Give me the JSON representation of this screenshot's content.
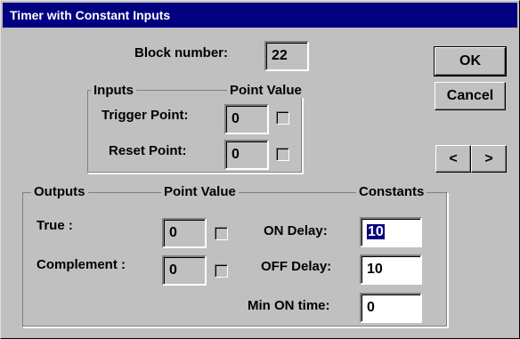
{
  "window": {
    "title": "Timer with Constant Inputs"
  },
  "block": {
    "label": "Block number:",
    "value": "22"
  },
  "inputs": {
    "group_label": "Inputs",
    "point_value_header": "Point Value",
    "trigger": {
      "label": "Trigger Point:",
      "value": "0",
      "checked": false
    },
    "reset": {
      "label": "Reset Point:",
      "value": "0",
      "checked": false
    }
  },
  "outputs": {
    "group_label": "Outputs",
    "point_value_header": "Point Value",
    "constants_header": "Constants",
    "true_row": {
      "label": "True :",
      "value": "0",
      "checked": false
    },
    "complement_row": {
      "label": "Complement :",
      "value": "0",
      "checked": false
    },
    "on_delay": {
      "label": "ON Delay:",
      "value": "10",
      "selected": true
    },
    "off_delay": {
      "label": "OFF Delay:",
      "value": "10"
    },
    "min_on_time": {
      "label": "Min ON time:",
      "value": "0"
    }
  },
  "buttons": {
    "ok": "OK",
    "cancel": "Cancel",
    "prev": "<",
    "next": ">"
  }
}
